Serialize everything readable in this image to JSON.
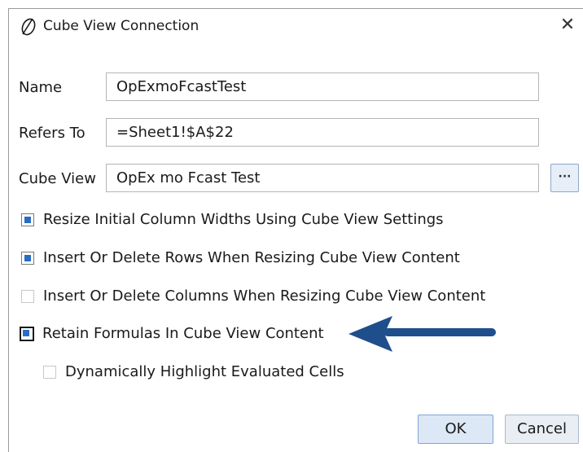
{
  "dialog": {
    "title": "Cube View Connection",
    "close_glyph": "✕",
    "icon": "onestream-logo-icon"
  },
  "fields": {
    "name_label": "Name",
    "name_value": "OpExmoFcastTest",
    "refers_to_label": "Refers To",
    "refers_to_value": "=Sheet1!$A$22",
    "cube_view_label": "Cube View",
    "cube_view_value": "OpEx mo Fcast Test",
    "browse_label": "···"
  },
  "options": [
    {
      "label": "Resize Initial Column Widths Using Cube View Settings",
      "checked": true
    },
    {
      "label": "Insert Or Delete Rows When Resizing Cube View Content",
      "checked": true
    },
    {
      "label": "Insert Or Delete Columns When Resizing Cube View Content",
      "checked": false
    },
    {
      "label": "Retain Formulas In Cube View Content",
      "checked": true
    },
    {
      "label": "Dynamically Highlight Evaluated Cells",
      "checked": false
    }
  ],
  "annotation": {
    "icon": "left-arrow-icon",
    "color": "#1f4e8c"
  },
  "buttons": {
    "ok": "OK",
    "cancel": "Cancel"
  },
  "colors": {
    "accent": "#2a6cc4",
    "ok_bg": "#dce8f6",
    "cancel_bg": "#e9eef4"
  }
}
